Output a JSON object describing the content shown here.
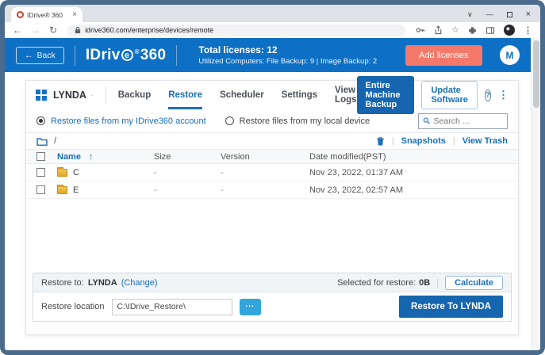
{
  "icons": {
    "back_arrow": "←",
    "forward_arrow": "→",
    "reload": "↻",
    "star": "☆",
    "overflow_kebab": "⋮",
    "tab_search_chevron": "∨",
    "minimize": "—",
    "close": "×",
    "help": "?",
    "sort_ascending": "↑",
    "separator": "|",
    "ellipsis": "..."
  },
  "browser": {
    "tab_title": "IDrive® 360",
    "url": "idrive360.com/enterprise/devices/remote"
  },
  "app_header": {
    "back_label": "Back",
    "logo": {
      "prefix": "IDriv",
      "e": "e",
      "reg": "®",
      "suffix": "360"
    },
    "total_licenses": "Total licenses: 12",
    "utilized": "Utilized Computers: File Backup: 9 |  Image Backup: 2",
    "add_licenses_label": "Add licenses",
    "avatar_initial": "M"
  },
  "machine": {
    "name": "LYNDA",
    "tabs": [
      {
        "label": "Backup"
      },
      {
        "label": "Restore"
      },
      {
        "label": "Scheduler"
      },
      {
        "label": "Settings"
      },
      {
        "label": "View Logs"
      }
    ],
    "entire_machine_backup_label": "Entire Machine Backup",
    "update_software_label": "Update Software"
  },
  "restore_source": {
    "options": [
      {
        "label": "Restore files from my IDrive360 account",
        "selected": true
      },
      {
        "label": "Restore files from my local device",
        "selected": false
      }
    ]
  },
  "search": {
    "placeholder": "Search ..."
  },
  "breadcrumb": {
    "path": "/"
  },
  "actions": {
    "snapshots_label": "Snapshots",
    "view_trash_label": "View Trash"
  },
  "table": {
    "headers": {
      "name": "Name",
      "size": "Size",
      "version": "Version",
      "date": "Date modified(PST)"
    },
    "rows": [
      {
        "name": "C",
        "size": "-",
        "version": "-",
        "date": "Nov 23, 2022, 01:37 AM"
      },
      {
        "name": "E",
        "size": "-",
        "version": "-",
        "date": "Nov 23, 2022, 02:57 AM"
      }
    ]
  },
  "footer": {
    "restore_to_label": "Restore to:",
    "restore_to_value": "LYNDA",
    "change_label": "(Change)",
    "selected_label": "Selected for restore:",
    "selected_value": "0B",
    "calculate_label": "Calculate",
    "location_label": "Restore location",
    "location_value": "C:\\IDrive_Restore\\",
    "restore_button_label": "Restore To LYNDA"
  },
  "colors": {
    "header_blue": "#0e70c4",
    "accent_blue": "#1a6fba",
    "button_blue": "#1565af",
    "salmon": "#f4796b",
    "browse_blue": "#31a5dc",
    "folder_yellow": "#eeb42f"
  }
}
